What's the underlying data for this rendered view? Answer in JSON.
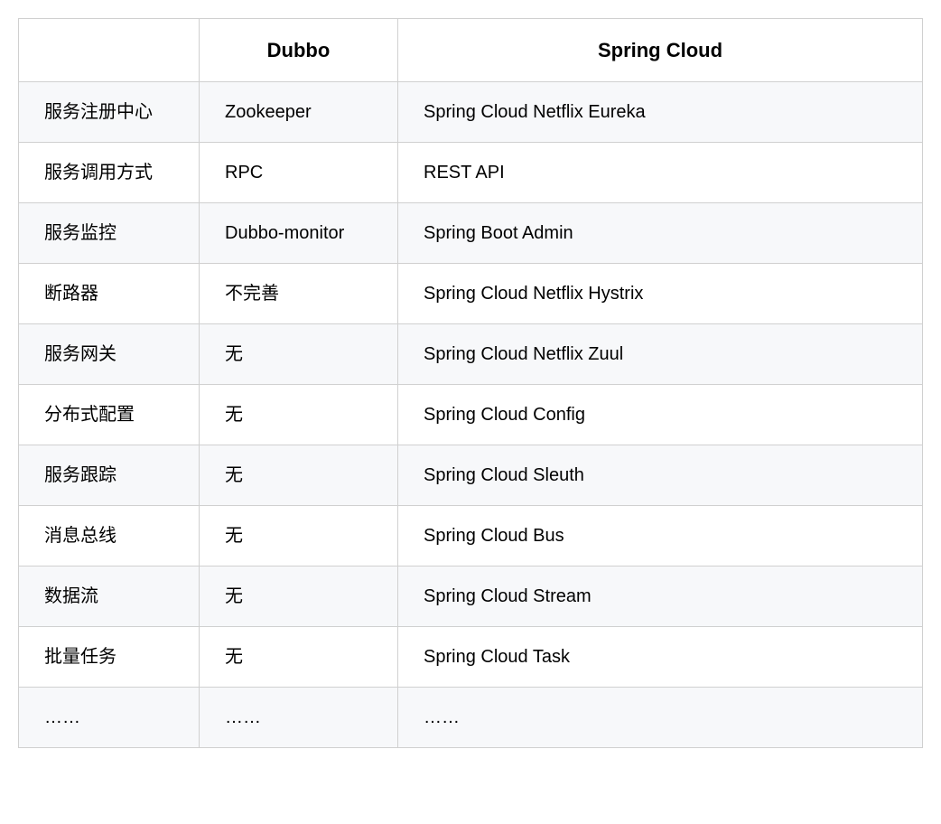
{
  "table": {
    "headers": [
      "",
      "Dubbo",
      "Spring Cloud"
    ],
    "rows": [
      {
        "feature": "服务注册中心",
        "dubbo": "Zookeeper",
        "springcloud": "Spring Cloud Netflix Eureka"
      },
      {
        "feature": "服务调用方式",
        "dubbo": "RPC",
        "springcloud": "REST API"
      },
      {
        "feature": "服务监控",
        "dubbo": "Dubbo-monitor",
        "springcloud": "Spring Boot Admin"
      },
      {
        "feature": "断路器",
        "dubbo": "不完善",
        "springcloud": "Spring Cloud Netflix Hystrix"
      },
      {
        "feature": "服务网关",
        "dubbo": "无",
        "springcloud": "Spring Cloud Netflix Zuul"
      },
      {
        "feature": "分布式配置",
        "dubbo": "无",
        "springcloud": "Spring Cloud Config"
      },
      {
        "feature": "服务跟踪",
        "dubbo": "无",
        "springcloud": "Spring Cloud Sleuth"
      },
      {
        "feature": "消息总线",
        "dubbo": "无",
        "springcloud": "Spring Cloud Bus"
      },
      {
        "feature": "数据流",
        "dubbo": "无",
        "springcloud": "Spring Cloud Stream"
      },
      {
        "feature": "批量任务",
        "dubbo": "无",
        "springcloud": "Spring Cloud Task"
      },
      {
        "feature": "……",
        "dubbo": "……",
        "springcloud": "……"
      }
    ]
  }
}
